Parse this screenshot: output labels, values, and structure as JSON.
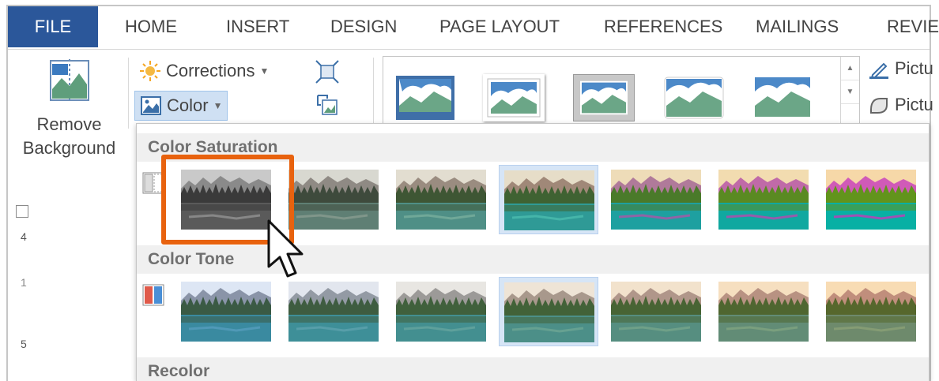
{
  "tabs": [
    "FILE",
    "HOME",
    "INSERT",
    "DESIGN",
    "PAGE LAYOUT",
    "REFERENCES",
    "MAILINGS",
    "REVIE"
  ],
  "ribbon": {
    "remove_background": "Remove Background",
    "corrections": "Corrections",
    "color": "Color",
    "picture_border": "Pictu",
    "picture_effects": "Pictu"
  },
  "ruler": {
    "marks": [
      "4",
      "1",
      "5"
    ]
  },
  "panel": {
    "sections": [
      {
        "title": "Color Saturation"
      },
      {
        "title": "Color Tone"
      },
      {
        "title": "Recolor"
      }
    ]
  },
  "colors": {
    "file_tab": "#2b579a",
    "highlight": "#e8620e",
    "selected_bg": "#d6e5f6"
  },
  "icons": [
    "remove-background-icon",
    "corrections-sun-icon",
    "color-icon",
    "compress-icon",
    "change-picture-icon",
    "picture-border-icon",
    "picture-effects-icon",
    "swatch-icon",
    "cursor-icon"
  ]
}
